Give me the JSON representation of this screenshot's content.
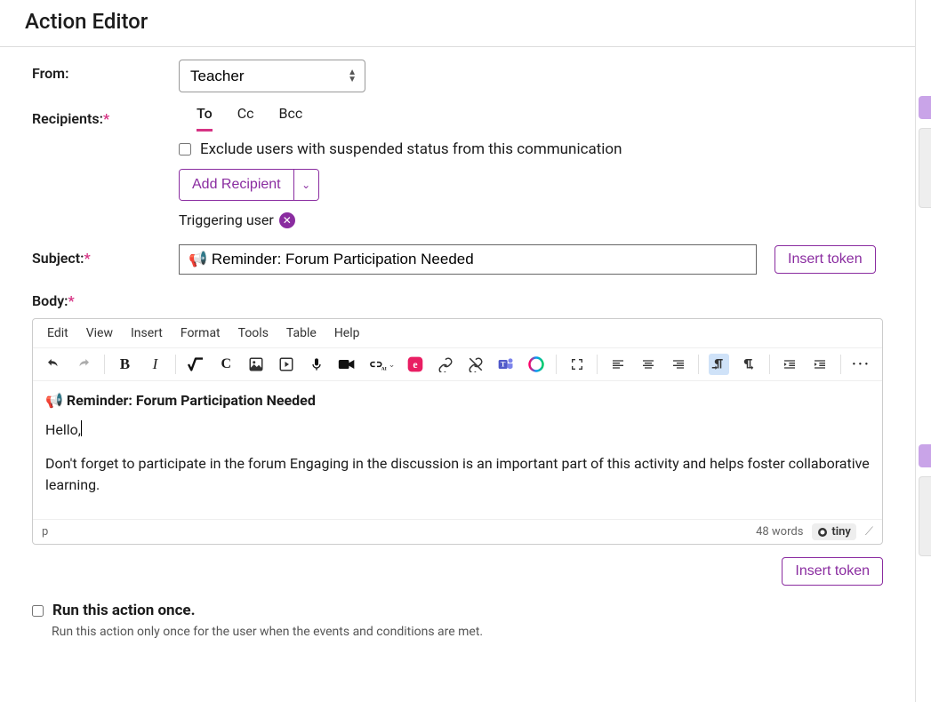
{
  "title": "Action Editor",
  "from": {
    "label": "From:",
    "value": "Teacher"
  },
  "recipients": {
    "label": "Recipients:",
    "tabs": {
      "to": "To",
      "cc": "Cc",
      "bcc": "Bcc"
    },
    "exclude_label": "Exclude users with suspended status from this communication",
    "add_button": "Add Recipient",
    "chip": "Triggering user"
  },
  "subject": {
    "label": "Subject:",
    "value": "📢 Reminder: Forum Participation Needed",
    "insert_token": "Insert token"
  },
  "body": {
    "label": "Body:",
    "menu": [
      "Edit",
      "View",
      "Insert",
      "Format",
      "Tools",
      "Table",
      "Help"
    ],
    "heading": "📢 Reminder: Forum Participation Needed",
    "greeting": "Hello,",
    "para": "Don't forget to participate in the forum  Engaging in the discussion is an important part of this activity and helps foster collaborative learning.",
    "path": "p",
    "word_count": "48 words",
    "brand": "tiny",
    "insert_token": "Insert token"
  },
  "run_once": {
    "label": "Run this action once.",
    "desc": "Run this action only once for the user when the events and conditions are met."
  }
}
